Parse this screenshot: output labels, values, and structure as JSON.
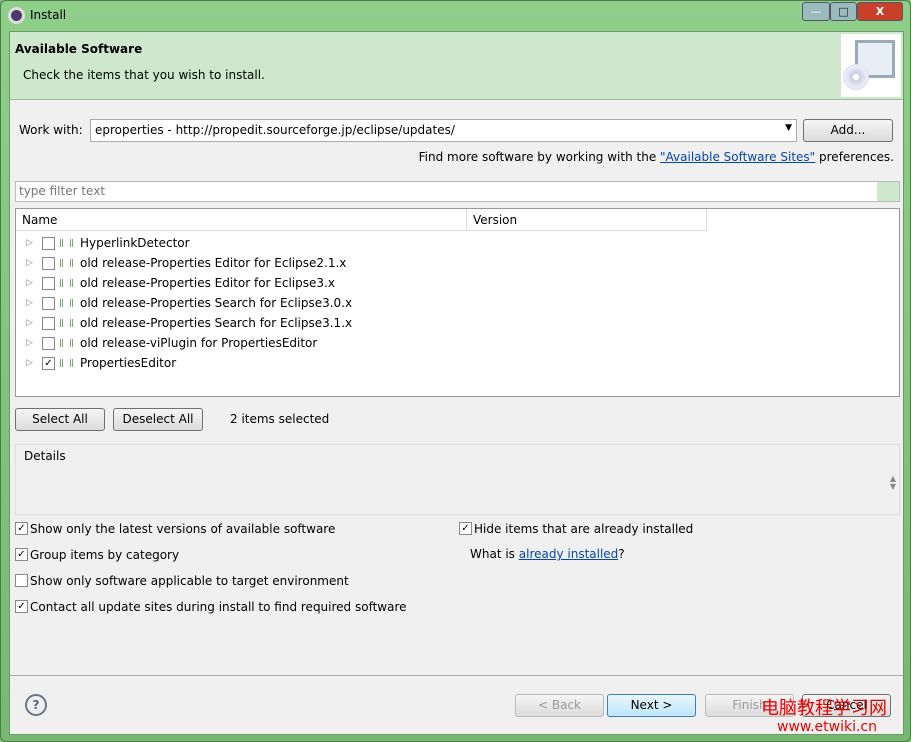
{
  "window": {
    "title": "Install",
    "minimize": "—",
    "maximize": "□",
    "close": "X"
  },
  "banner": {
    "title": "Available Software",
    "subtitle": "Check the items that you wish to install."
  },
  "work_with": {
    "label": "Work with:",
    "value": "eproperties - http://propedit.sourceforge.jp/eclipse/updates/",
    "add_button": "Add...",
    "more_prefix": "Find more software by working with the ",
    "more_link": "\"Available Software Sites\"",
    "more_suffix": " preferences."
  },
  "filter": {
    "placeholder": "type filter text"
  },
  "tree": {
    "columns": [
      "Name",
      "Version"
    ],
    "items": [
      {
        "label": "HyperlinkDetector",
        "checked": false
      },
      {
        "label": "old release-Properties Editor for Eclipse2.1.x",
        "checked": false
      },
      {
        "label": "old release-Properties Editor for Eclipse3.x",
        "checked": false
      },
      {
        "label": "old release-Properties Search for Eclipse3.0.x",
        "checked": false
      },
      {
        "label": "old release-Properties Search for Eclipse3.1.x",
        "checked": false
      },
      {
        "label": "old release-viPlugin for PropertiesEditor",
        "checked": false
      },
      {
        "label": "PropertiesEditor",
        "checked": true
      }
    ]
  },
  "selection": {
    "select_all": "Select All",
    "deselect_all": "Deselect All",
    "status": "2 items selected"
  },
  "details": {
    "label": "Details"
  },
  "options": {
    "latest": {
      "label": "Show only the latest versions of available software",
      "checked": true
    },
    "hide": {
      "label": "Hide items that are already installed",
      "checked": true
    },
    "group": {
      "label": "Group items by category",
      "checked": true
    },
    "applicable": {
      "label": "Show only software applicable to target environment",
      "checked": false
    },
    "contact": {
      "label": "Contact all update sites during install to find required software",
      "checked": true
    },
    "what_prefix": "What is ",
    "what_link": "already installed",
    "what_suffix": "?"
  },
  "footer": {
    "help": "?",
    "back": "< Back",
    "next": "Next >",
    "finish": "Finish",
    "cancel": "Cancel"
  },
  "watermark": {
    "line1": "电脑教程学习网",
    "line2": "www.etwiki.cn"
  }
}
